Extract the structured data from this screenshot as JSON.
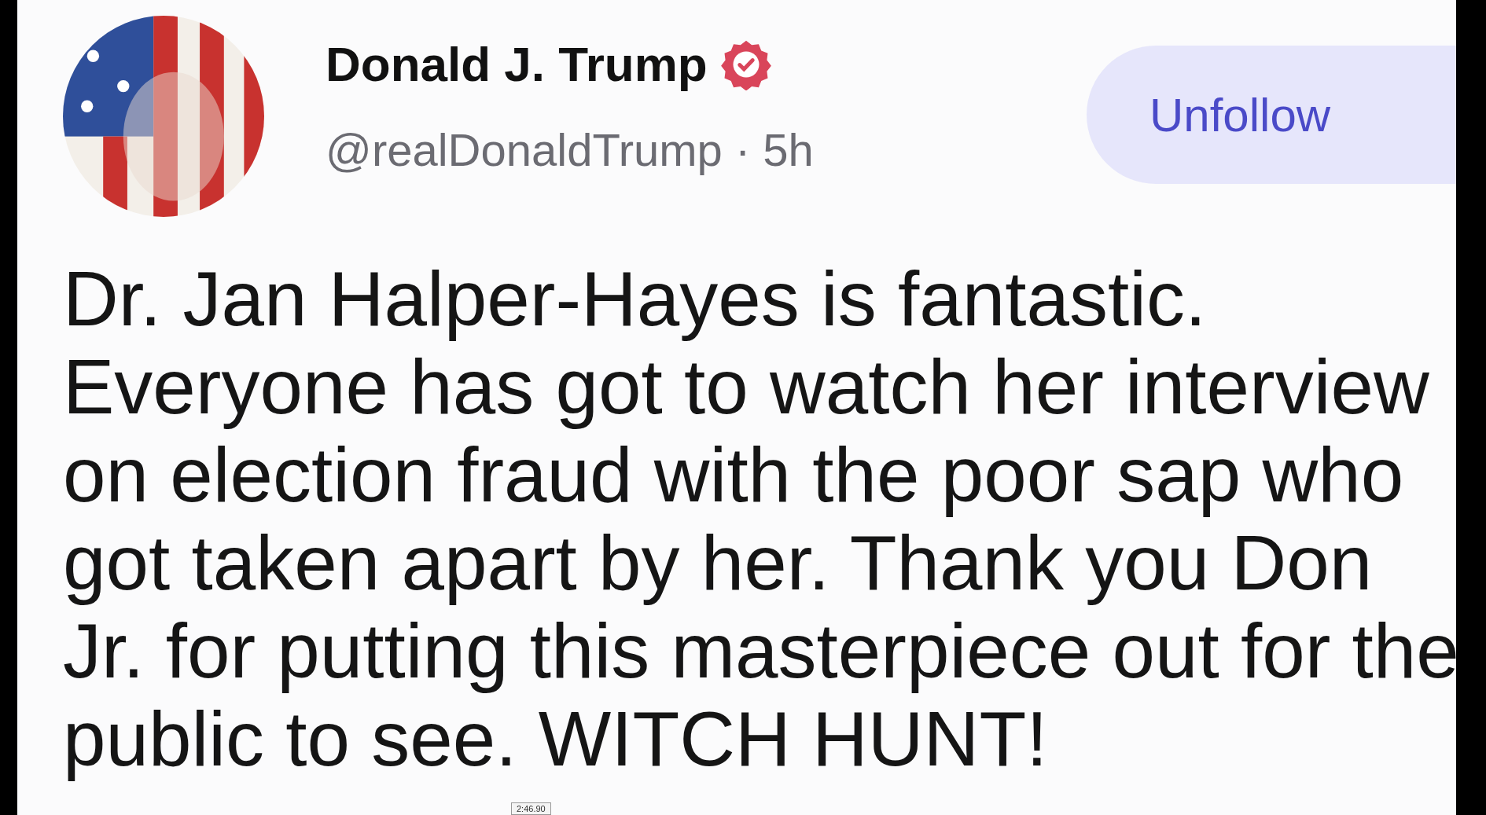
{
  "post": {
    "author": {
      "name": "Donald J. Trump",
      "verified": true,
      "handle": "@realDonaldTrump",
      "separator": "·",
      "time": "5h"
    },
    "follow_button": {
      "label": "Unfollow"
    },
    "text": "Dr. Jan Halper-Hayes is fantastic. Everyone has got to watch her interview on election fraud with the poor sap who got taken apart by her. Thank you Don Jr. for putting this masterpiece out for the public to see. WITCH HUNT!"
  },
  "video_timestamp": "2:46.90"
}
